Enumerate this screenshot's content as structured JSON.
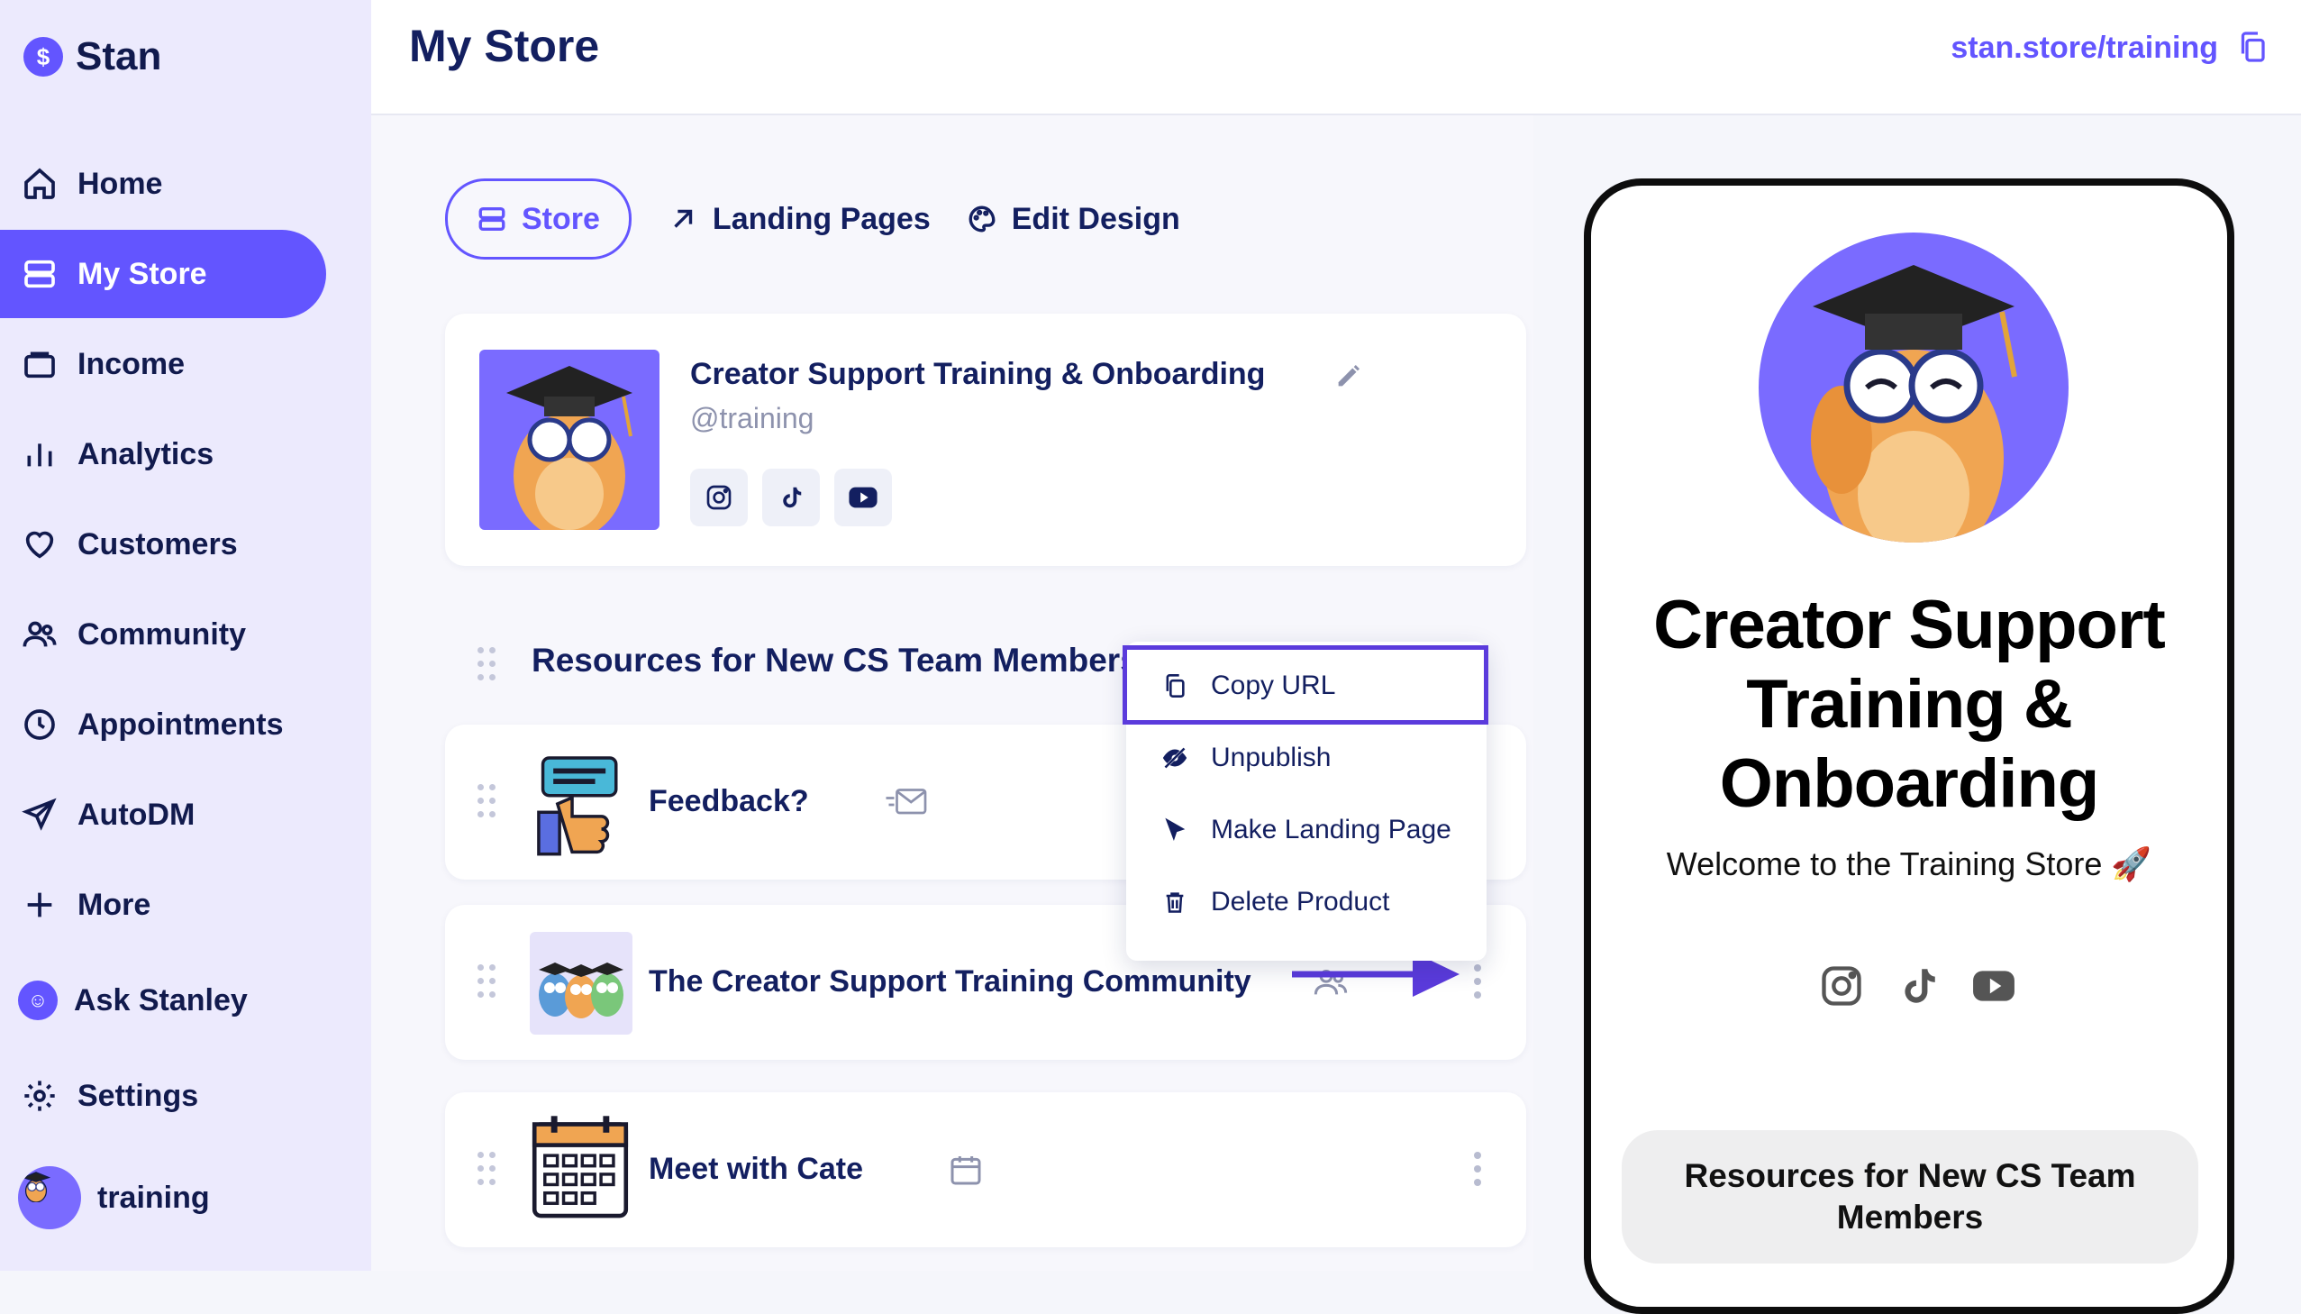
{
  "brand": {
    "name": "Stan",
    "logo_glyph": "$"
  },
  "sidebar": {
    "items": [
      {
        "label": "Home",
        "icon": "home-icon"
      },
      {
        "label": "My Store",
        "icon": "store-icon",
        "active": true
      },
      {
        "label": "Income",
        "icon": "wallet-icon"
      },
      {
        "label": "Analytics",
        "icon": "bar-chart-icon"
      },
      {
        "label": "Customers",
        "icon": "heart-icon"
      },
      {
        "label": "Community",
        "icon": "users-icon"
      },
      {
        "label": "Appointments",
        "icon": "clock-icon"
      },
      {
        "label": "AutoDM",
        "icon": "send-icon"
      },
      {
        "label": "More",
        "icon": "plus-icon"
      },
      {
        "label": "Ask Stanley",
        "icon": "stanley-icon"
      },
      {
        "label": "Settings",
        "icon": "gear-icon"
      },
      {
        "label": "training",
        "icon": "avatar"
      }
    ]
  },
  "header": {
    "title": "My Store",
    "store_url": "stan.store/training"
  },
  "tabs": [
    {
      "label": "Store",
      "selected": true
    },
    {
      "label": "Landing Pages"
    },
    {
      "label": "Edit Design"
    }
  ],
  "profile": {
    "name": "Creator Support Training & Onboarding",
    "handle": "@training",
    "socials": [
      "instagram-icon",
      "tiktok-icon",
      "youtube-icon"
    ]
  },
  "section": {
    "title": "Resources for New CS Team Members"
  },
  "products": [
    {
      "title": "Feedback?",
      "type_icon": "email-icon",
      "thumb": "thumbs-up-icon"
    },
    {
      "title": "The Creator Support Training Community",
      "type_icon": "users-icon",
      "thumb": "owls-thumbnail"
    },
    {
      "title": "Meet with Cate",
      "type_icon": "calendar-icon",
      "thumb": "calendar-thumbnail"
    }
  ],
  "menu": {
    "items": [
      {
        "label": "Copy URL",
        "icon": "copy-icon"
      },
      {
        "label": "Unpublish",
        "icon": "eye-off-icon"
      },
      {
        "label": "Make Landing Page",
        "icon": "cursor-icon"
      },
      {
        "label": "Delete Product",
        "icon": "trash-icon"
      }
    ]
  },
  "phone": {
    "title": "Creator Support Training & Onboarding",
    "subtitle": "Welcome to the Training Store 🚀",
    "button": "Resources for New CS Team Members"
  },
  "colors": {
    "accent": "#6355ff",
    "navy": "#131f60",
    "sidebar_bg": "#eceafd",
    "highlight_border": "#5b3bdc"
  }
}
